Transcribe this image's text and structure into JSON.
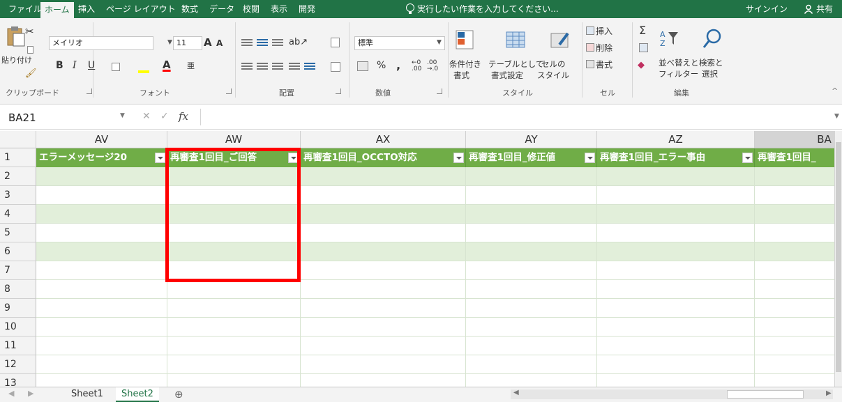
{
  "ribbon_tabs": [
    "ファイル",
    "ホーム",
    "挿入",
    "ページ レイアウト",
    "数式",
    "データ",
    "校閲",
    "表示",
    "開発"
  ],
  "tell_me": "実行したい作業を入力してください...",
  "signin": "サインイン",
  "share": "共有",
  "clipboard": {
    "paste": "貼り付け",
    "group": "クリップボード"
  },
  "font": {
    "name": "メイリオ",
    "size": "11",
    "group": "フォント",
    "bold": "B",
    "italic": "I",
    "underline": "U"
  },
  "alignment": {
    "group": "配置"
  },
  "number": {
    "format": "標準",
    "percent": "%",
    "comma": ",",
    "group": "数値"
  },
  "styles": {
    "cond": [
      "条件付き",
      "書式"
    ],
    "table": [
      "テーブルとして",
      "書式設定"
    ],
    "cell": [
      "セルの",
      "スタイル"
    ],
    "group": "スタイル"
  },
  "cells": {
    "insert": "挿入",
    "delete": "削除",
    "format": "書式",
    "group": "セル"
  },
  "editing": {
    "sort": [
      "並べ替えと",
      "フィルター"
    ],
    "find": [
      "検索と",
      "選択"
    ],
    "group": "編集"
  },
  "formula_bar": {
    "name_box": "BA21",
    "fx": "fx"
  },
  "columns": [
    "AV",
    "AW",
    "AX",
    "AY",
    "AZ",
    "BA"
  ],
  "header_row": [
    "エラーメッセージ20",
    "再審査1回目_ご回答",
    "再審査1回目_OCCTO対応",
    "再審査1回目_修正値",
    "再審査1回目_エラー事由",
    "再審査1回目_"
  ],
  "rows": [
    "1",
    "2",
    "3",
    "4",
    "5",
    "6",
    "7",
    "8",
    "9",
    "10",
    "11",
    "12",
    "13"
  ],
  "sheets": [
    "Sheet1",
    "Sheet2"
  ],
  "active_sheet": "Sheet2",
  "colors": {
    "accent": "#217346",
    "header_fill": "#70ad47",
    "band_fill": "#e2efda",
    "highlight": "#ff0000"
  }
}
